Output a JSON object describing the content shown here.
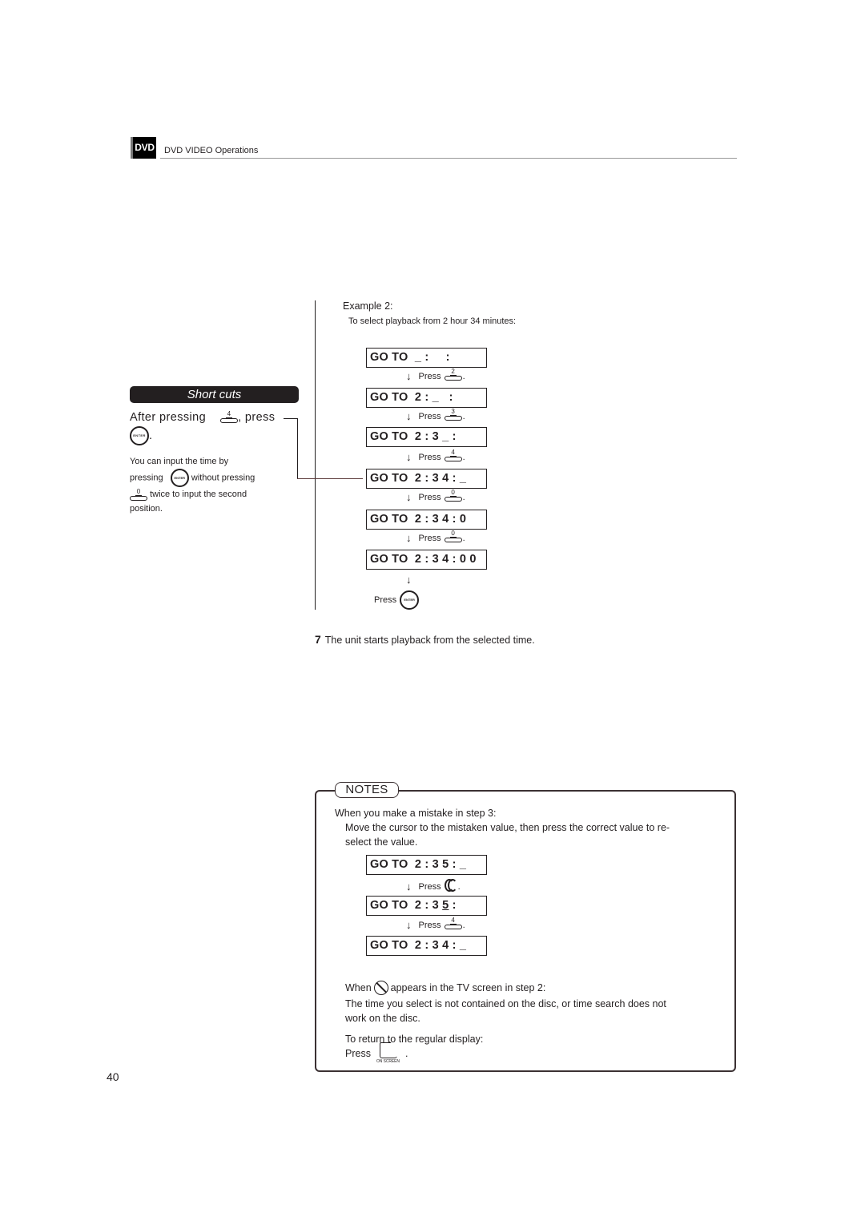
{
  "header": {
    "badge": "DVD",
    "section_title": "DVD VIDEO Operations"
  },
  "shortcuts": {
    "title": "Short cuts",
    "after_text_1": "After pressing",
    "after_key": "4",
    "after_text_2": ", press",
    "after_end": ".",
    "enter_label": "ENTER",
    "note_line1": "You can input the time by",
    "note_pressing": "pressing",
    "note_without": "without pressing",
    "note_key": "0",
    "note_twice": "twice to input the second",
    "note_position": "position."
  },
  "example": {
    "title": "Example 2:",
    "subtitle": "To select playback from 2 hour 34 minutes:",
    "steps": [
      {
        "display": "GO TO  _ :     :",
        "press_label": "Press",
        "key": "2"
      },
      {
        "display": "GO TO  2 : _   :",
        "press_label": "Press",
        "key": "3"
      },
      {
        "display": "GO TO  2 : 3 _ :",
        "press_label": "Press",
        "key": "4"
      },
      {
        "display": "GO TO  2 : 3 4 : _",
        "press_label": "Press",
        "key": "0"
      },
      {
        "display": "GO TO  2 : 3 4 : 0",
        "press_label": "Press",
        "key": "0"
      },
      {
        "display": "GO TO  2 : 3 4 : 0 0",
        "press_label": "Press",
        "key": "ENTER"
      }
    ],
    "arrow": "↓"
  },
  "step7": {
    "number": "7",
    "text": "The unit starts playback from the selected time."
  },
  "notes": {
    "tab_label": "NOTES",
    "mistake_heading": "When you make a mistake in step 3:",
    "mistake_body_1": "Move the cursor to the mistaken value, then press the correct value to re-",
    "mistake_body_2": "select the value.",
    "steps": [
      {
        "display": "GO TO  2 : 3 5 : _",
        "press_label": "Press",
        "key": "rewind"
      },
      {
        "display_prefix": "GO TO  2 : 3 ",
        "display_underlined": "5",
        "display_suffix": " :",
        "press_label": "Press",
        "key": "4"
      },
      {
        "display": "GO TO  2 : 3 4 : _"
      }
    ],
    "noentry_when": "When",
    "noentry_after": "appears in the TV screen in step 2:",
    "noentry_body_1": "The time you select is not contained on the disc, or time search does not",
    "noentry_body_2": "work on the disc.",
    "return_heading": "To return to the regular display:",
    "return_press": "Press",
    "return_end": ".",
    "onscreen_label": "ON SCREEN"
  },
  "page_number": "40"
}
